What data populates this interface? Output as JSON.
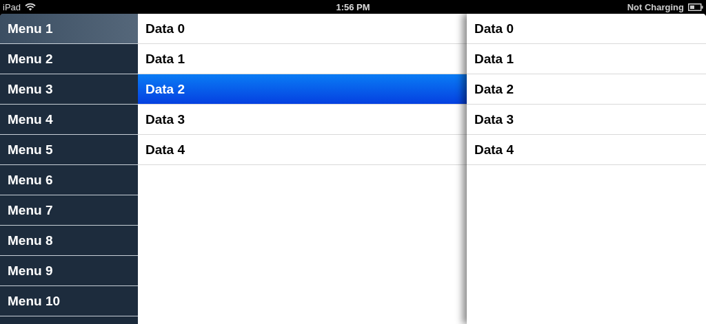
{
  "status_bar": {
    "device": "iPad",
    "time": "1:56 PM",
    "battery_status": "Not Charging"
  },
  "menu": [
    {
      "label": "Menu 1",
      "selected": true
    },
    {
      "label": "Menu 2",
      "selected": false
    },
    {
      "label": "Menu 3",
      "selected": false
    },
    {
      "label": "Menu 4",
      "selected": false
    },
    {
      "label": "Menu 5",
      "selected": false
    },
    {
      "label": "Menu 6",
      "selected": false
    },
    {
      "label": "Menu 7",
      "selected": false
    },
    {
      "label": "Menu 8",
      "selected": false
    },
    {
      "label": "Menu 9",
      "selected": false
    },
    {
      "label": "Menu 10",
      "selected": false
    }
  ],
  "list": [
    {
      "label": "Data 0",
      "selected": false
    },
    {
      "label": "Data 1",
      "selected": false
    },
    {
      "label": "Data 2",
      "selected": true
    },
    {
      "label": "Data 3",
      "selected": false
    },
    {
      "label": "Data 4",
      "selected": false
    }
  ],
  "detail_list": [
    {
      "label": "Data 0"
    },
    {
      "label": "Data 1"
    },
    {
      "label": "Data 2"
    },
    {
      "label": "Data 3"
    },
    {
      "label": "Data 4"
    }
  ]
}
